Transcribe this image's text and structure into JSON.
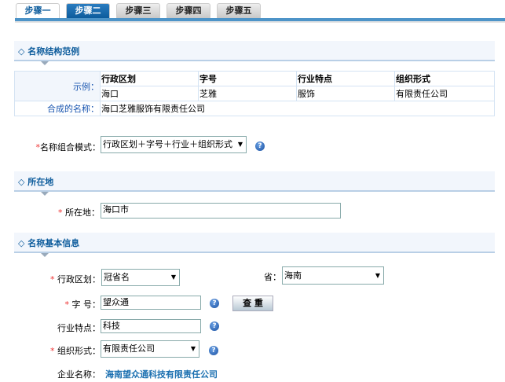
{
  "tabs": [
    "步骤一",
    "步骤二",
    "步骤三",
    "步骤四",
    "步骤五"
  ],
  "section1": {
    "title": "名称结构范例",
    "example_label": "示例：",
    "headers": [
      "行政区划",
      "字号",
      "行业特点",
      "组织形式"
    ],
    "values": [
      "海口",
      "芝雅",
      "服饰",
      "有限责任公司"
    ],
    "composed_label": "合成的名称：",
    "composed_value": "海口芝雅服饰有限责任公司"
  },
  "mode": {
    "label": "名称组合模式：",
    "value": "行政区划＋字号＋行业＋组织形式"
  },
  "section2": {
    "title": "所在地",
    "label": "所在地：",
    "value": "海口市"
  },
  "section3": {
    "title": "名称基本信息",
    "region_label": "行政区划：",
    "region_value": "冠省名",
    "province_label": "省：",
    "province_value": "海南",
    "zihao_label": "字 号：",
    "zihao_value": "望众通",
    "check_button": "查 重",
    "industry_label": "行业特点：",
    "industry_value": "科技",
    "org_label": "组织形式：",
    "org_value": "有限责任公司",
    "company_label": "企业名称：",
    "company_value": "海南望众通科技有限责任公司"
  },
  "colors": {
    "accent": "#0d5c9c",
    "required": "#e33"
  }
}
